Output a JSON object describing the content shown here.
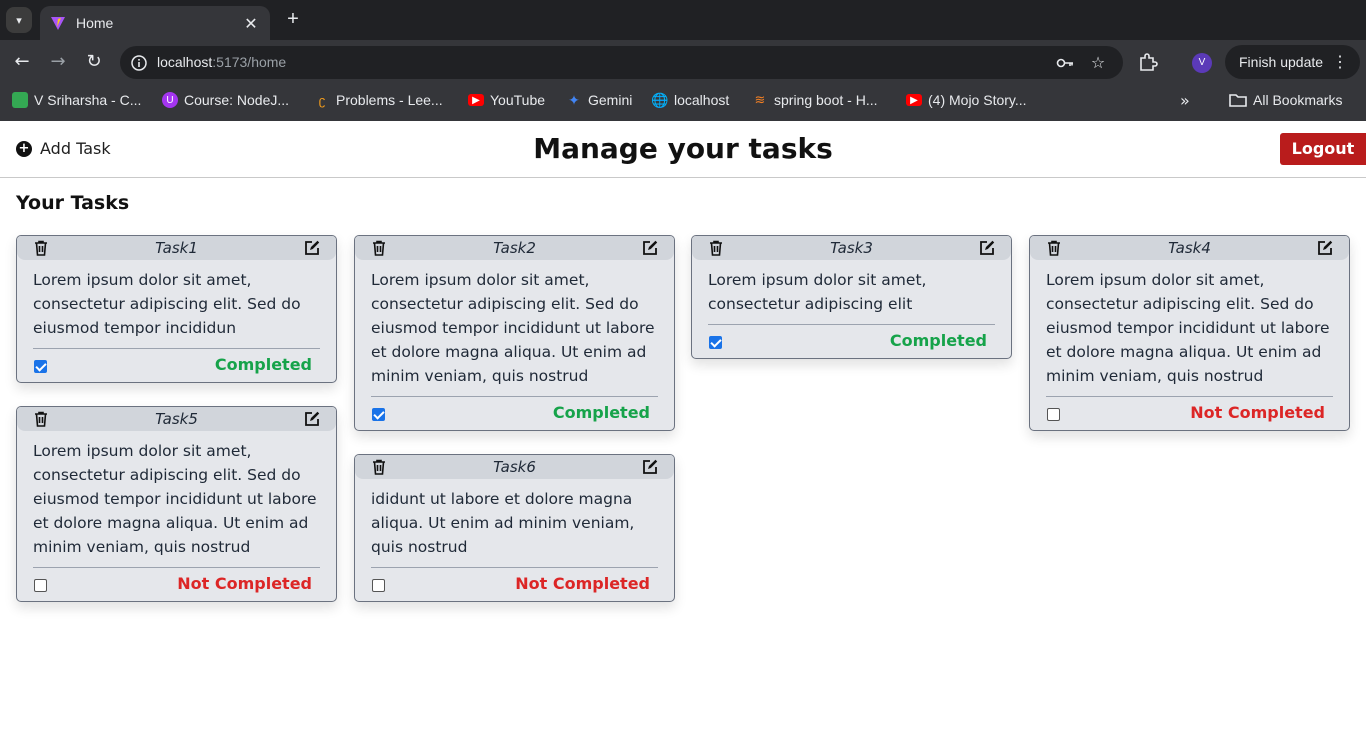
{
  "browser": {
    "tab_title": "Home",
    "url_host": "localhost",
    "url_path": ":5173/home",
    "finish_update": "Finish update",
    "profile_initial": "V",
    "bookmarks": [
      {
        "label": "V Sriharsha - C...",
        "icon": "chat-icon",
        "color": "#34a853"
      },
      {
        "label": "Course: NodeJ...",
        "icon": "udemy-icon",
        "color": "#a435f0"
      },
      {
        "label": "Problems - Lee...",
        "icon": "leetcode-icon",
        "color": "#f89f1b"
      },
      {
        "label": "YouTube",
        "icon": "youtube-icon",
        "color": "#ff0000"
      },
      {
        "label": "Gemini",
        "icon": "gemini-icon",
        "color": "#4285f4"
      },
      {
        "label": "localhost",
        "icon": "globe-icon",
        "color": "#e8eaed"
      },
      {
        "label": "spring boot - H...",
        "icon": "stackoverflow-icon",
        "color": "#f48024"
      },
      {
        "label": "(4) Mojo Story...",
        "icon": "youtube-icon",
        "color": "#ff0000"
      }
    ],
    "all_bookmarks": "All Bookmarks"
  },
  "header": {
    "add_task": "Add Task",
    "title": "Manage your tasks",
    "logout": "Logout"
  },
  "section_title": "Your Tasks",
  "tasks": [
    {
      "title": "Task1",
      "body": "Lorem ipsum dolor sit amet, consectetur adipiscing elit. Sed do eiusmod tempor incididun",
      "checked": true,
      "status": "Completed"
    },
    {
      "title": "Task2",
      "body": "Lorem ipsum dolor sit amet, consectetur adipiscing elit. Sed do eiusmod tempor incididunt ut labore et dolore magna aliqua. Ut enim ad minim veniam, quis nostrud",
      "checked": true,
      "status": "Completed"
    },
    {
      "title": "Task3",
      "body": "Lorem ipsum dolor sit amet, consectetur adipiscing elit",
      "checked": true,
      "status": "Completed"
    },
    {
      "title": "Task4",
      "body": "Lorem ipsum dolor sit amet, consectetur adipiscing elit. Sed do eiusmod tempor incididunt ut labore et dolore magna aliqua. Ut enim ad minim veniam, quis nostrud",
      "checked": false,
      "status": "Not Completed"
    },
    {
      "title": "Task5",
      "body": "Lorem ipsum dolor sit amet, consectetur adipiscing elit. Sed do eiusmod tempor incididunt ut labore et dolore magna aliqua. Ut enim ad minim veniam, quis nostrud",
      "checked": false,
      "status": "Not Completed"
    },
    {
      "title": "Task6",
      "body": "ididunt ut labore et dolore magna aliqua. Ut enim ad minim veniam, quis nostrud",
      "checked": false,
      "status": "Not Completed"
    }
  ],
  "colors": {
    "completed": "#16a34a",
    "not_completed": "#dc2626",
    "logout_bg": "#b91c1c",
    "card_bg": "#e5e7eb"
  }
}
